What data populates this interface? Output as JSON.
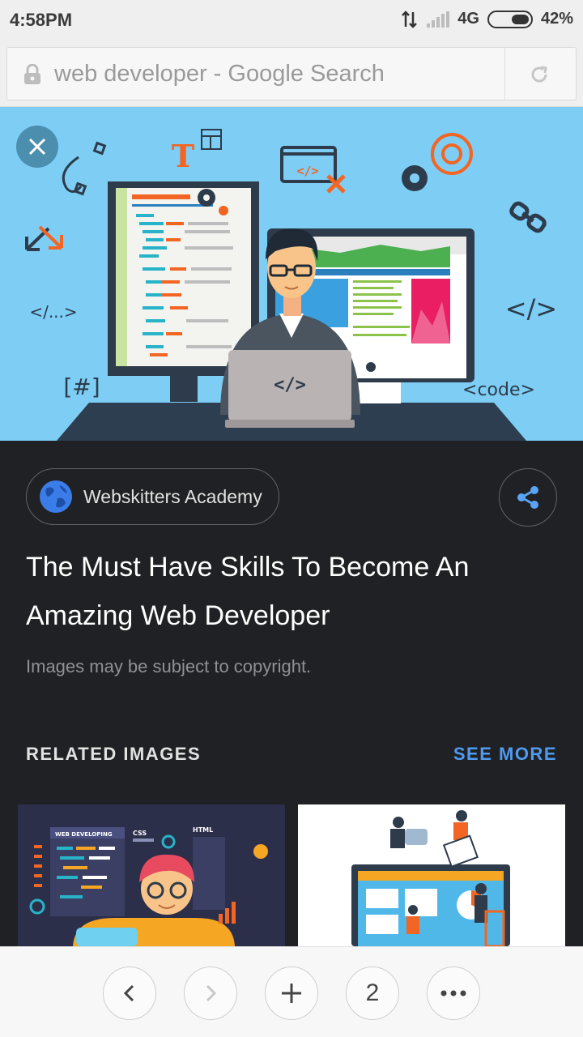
{
  "status_bar": {
    "time": "4:58PM",
    "network": "4G",
    "battery": "42%",
    "battery_level": 0.42,
    "icons": [
      "data-transfer-icon",
      "signal-icon",
      "battery-icon"
    ]
  },
  "url_bar": {
    "text": "web developer - Google Search",
    "lock_icon": "lock-icon",
    "reload_icon": "reload-icon"
  },
  "hero": {
    "close_icon": "close-icon",
    "illustration_texts": {
      "code_tag": "</>",
      "dots_tag": "</...>",
      "hash_tag": "[#]",
      "code_word": "<code>",
      "laptop_tag": "</>",
      "letter_t": "T"
    },
    "colors": {
      "sky": "#7dcdf5",
      "accent": "#f26522",
      "dark": "#283a4e"
    }
  },
  "result": {
    "source": "Webskitters Academy",
    "title": "The Must Have Skills To Become An Amazing Web Developer",
    "copyright_note": "Images may be subject to copyright.",
    "share_icon": "share-icon"
  },
  "related": {
    "label": "RELATED IMAGES",
    "see_more": "SEE MORE",
    "thumb1": {
      "tag1": "WEB DEVELOPING",
      "tag2": "CSS",
      "tag3": "HTML"
    }
  },
  "bottom_nav": {
    "back_icon": "chevron-left-icon",
    "forward_icon": "chevron-right-icon",
    "new_tab_icon": "plus-icon",
    "tabs_count": "2",
    "menu_icon": "more-icon"
  }
}
